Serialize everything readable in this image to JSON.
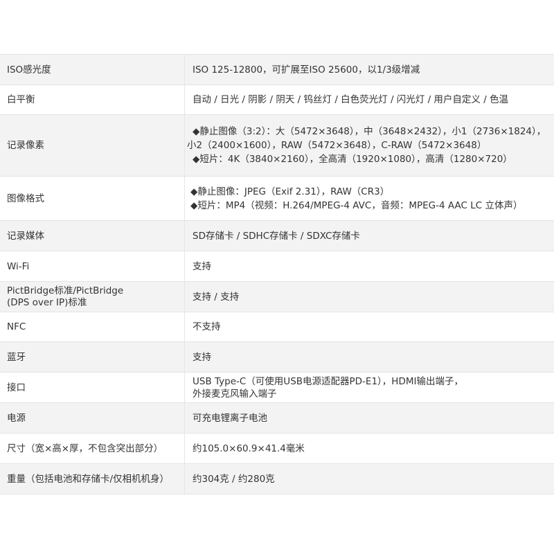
{
  "specs": [
    {
      "label": [
        "ISO感光度"
      ],
      "value": [
        "ISO 125-12800，可扩展至ISO 25600，以1/3级增减"
      ]
    },
    {
      "label": [
        "白平衡"
      ],
      "value": [
        "自动 / 日光 / 阴影 / 阴天 / 钨丝灯 / 白色荧光灯 / 闪光灯 / 用户自定义 / 色温"
      ]
    },
    {
      "label": [
        "记录像素"
      ],
      "value": [
        "◆静止图像（3:2）：大（5472×3648），中（3648×2432），小1（2736×1824），",
        "小2（2400×1600），RAW（5472×3648），C-RAW（5472×3648）",
        "◆短片：4K（3840×2160），全高清（1920×1080），高清（1280×720）"
      ]
    },
    {
      "label": [
        "图像格式"
      ],
      "value": [
        "◆静止图像：JPEG（Exif 2.31），RAW（CR3）",
        "◆短片：MP4（视频：H.264/MPEG-4 AVC，音频：MPEG-4 AAC LC 立体声）"
      ]
    },
    {
      "label": [
        "记录媒体"
      ],
      "value": [
        "SD存储卡 / SDHC存储卡 / SDXC存储卡"
      ]
    },
    {
      "label": [
        "Wi-Fi"
      ],
      "value": [
        "支持"
      ]
    },
    {
      "label": [
        "PictBridge标准/PictBridge",
        "(DPS over IP)标准"
      ],
      "value": [
        "支持 / 支持"
      ]
    },
    {
      "label": [
        "NFC"
      ],
      "value": [
        "不支持"
      ]
    },
    {
      "label": [
        "蓝牙"
      ],
      "value": [
        "支持"
      ]
    },
    {
      "label": [
        "接口"
      ],
      "value": [
        "USB Type-C（可使用USB电源适配器PD-E1），HDMI输出端子，",
        "外接麦克风输入端子"
      ]
    },
    {
      "label": [
        "电源"
      ],
      "value": [
        "可充电锂离子电池"
      ]
    },
    {
      "label": [
        "尺寸（宽×高×厚，不包含突出部分）"
      ],
      "value": [
        "约105.0×60.9×41.4毫米"
      ]
    },
    {
      "label": [
        "重量（包括电池和存储卡/仅相机机身）"
      ],
      "value": [
        "约304克 / 约280克"
      ]
    }
  ]
}
